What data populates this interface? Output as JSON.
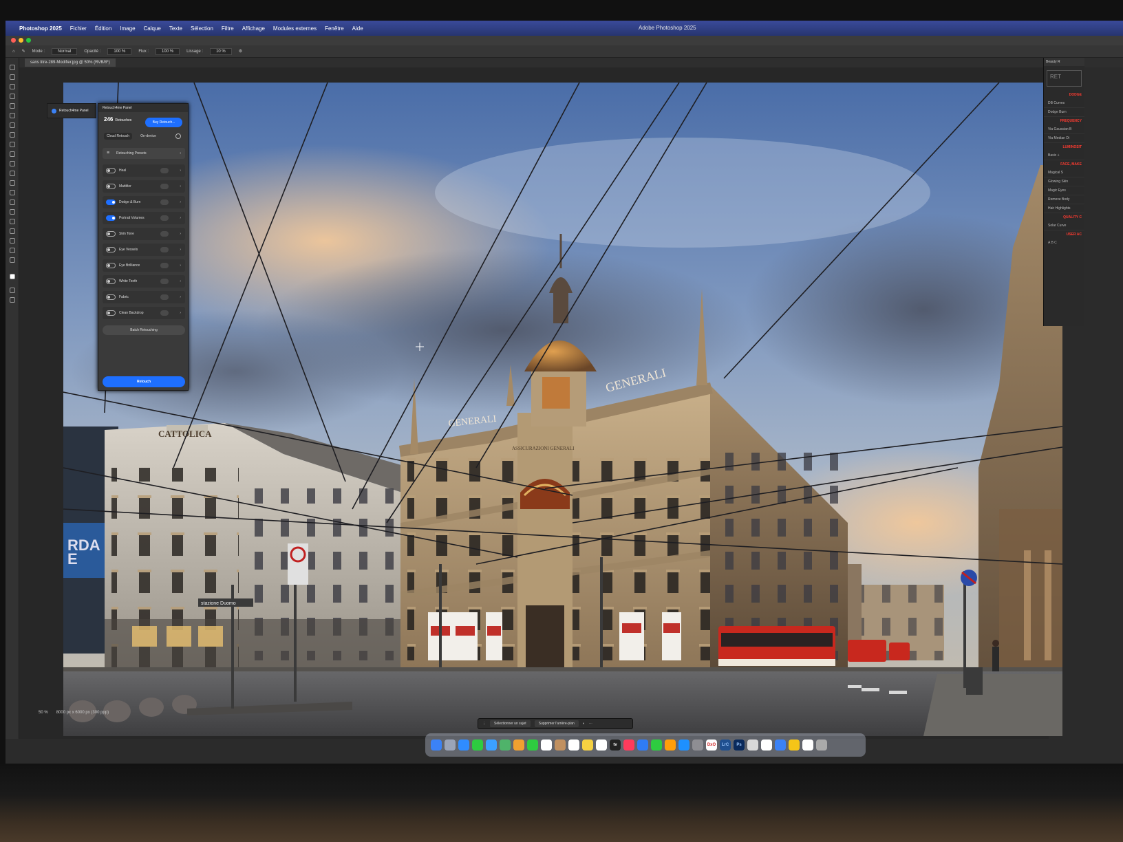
{
  "menubar": {
    "app_name": "Photoshop 2025",
    "items": [
      "Fichier",
      "Édition",
      "Image",
      "Calque",
      "Texte",
      "Sélection",
      "Filtre",
      "Affichage",
      "Modules externes",
      "Fenêtre",
      "Aide"
    ],
    "window_title": "Adobe Photoshop 2025"
  },
  "options": {
    "mode_label": "Mode :",
    "mode_value": "Normal",
    "opacity_label": "Opacité :",
    "opacity_value": "100 %",
    "flow_label": "Flux :",
    "flow_value": "100 %",
    "smoothing_label": "Lissage :",
    "smoothing_value": "10 %"
  },
  "document": {
    "tab_label": "sans titre-289-Modifier.jpg @ 50% (RVB/8*)",
    "zoom": "50 %",
    "info": "8000 px x 6000 px (300 ppp)"
  },
  "retouch_floatbar": {
    "label": "Retouch4me Panel"
  },
  "retouch_panel": {
    "title": "Retouch4me Panel",
    "count": "246",
    "count_label": "Retouches",
    "buy_label": "Buy Retouch...",
    "mode_cloud": "Cloud Retouch",
    "mode_device": "On-device",
    "presets_label": "Retouching Presets",
    "items": [
      {
        "label": "Heal",
        "on": false
      },
      {
        "label": "Mattifier",
        "on": false
      },
      {
        "label": "Dodge & Burn",
        "on": true
      },
      {
        "label": "Portrait Volumes",
        "on": true
      },
      {
        "label": "Skin Tone",
        "on": false
      },
      {
        "label": "Eye Vessels",
        "on": false
      },
      {
        "label": "Eye Brilliance",
        "on": false
      },
      {
        "label": "White Teeth",
        "on": false
      },
      {
        "label": "Fabric",
        "on": false
      },
      {
        "label": "Clean Backdrop",
        "on": false
      }
    ],
    "batch_label": "Batch Retouching",
    "retouch_label": "Retouch"
  },
  "right_panel": {
    "header": "Beauty R",
    "sections": [
      {
        "title": "DODGE",
        "items": [
          "DB Curves",
          "Dodge  Burn"
        ]
      },
      {
        "title": "FREQUENCY",
        "items": [
          "Via Gaussian B",
          "Via Median  Di"
        ]
      },
      {
        "title": "LUMINOSIT",
        "items": [
          "Basic  +"
        ]
      },
      {
        "title": "FACE, MAKE",
        "items": [
          "Magical S",
          "Glowing Skin",
          "Magic Eyes",
          "Remove Body",
          "Hair Highlights"
        ]
      },
      {
        "title": "QUALITY C",
        "items": [
          "Solar Curve"
        ]
      },
      {
        "title": "USER AC",
        "items": [
          "A  B  C"
        ]
      }
    ]
  },
  "taskbar": {
    "select_subject": "Sélectionner un sujet",
    "remove_background": "Supprimer l'arrière-plan"
  },
  "photo": {
    "sign_main": "GENERALI",
    "sign_main_right": "GENERALI",
    "sign_left": "CATTOLICA",
    "sign_inscription": "ASSICURAZIONI GENERALI",
    "street_sign": "stazione Duomo"
  },
  "dock": {
    "icons": [
      "finder-icon",
      "launchpad-icon",
      "safari-icon",
      "messages-icon",
      "mail-icon",
      "maps-icon",
      "photos-icon",
      "facetime-icon",
      "calendar-icon",
      "contacts-icon",
      "reminders-icon",
      "notes-icon",
      "freeform-icon",
      "tv-icon",
      "music-icon",
      "keynote-icon",
      "numbers-icon",
      "pages-icon",
      "appstore-icon",
      "settings-icon",
      "dxo-icon",
      "lrc-icon",
      "ps-icon",
      "vpn-icon",
      "chrome-icon",
      "finder2-icon",
      "script-icon",
      "preview-icon",
      "trash-icon"
    ],
    "labels": {
      "tv": "tv",
      "lrc": "LrC",
      "ps": "Ps",
      "dxo": "DxO"
    }
  },
  "colors": {
    "accent_blue": "#1e6fff",
    "plugin_red": "#ff3b30",
    "tram_red": "#c8281e"
  }
}
